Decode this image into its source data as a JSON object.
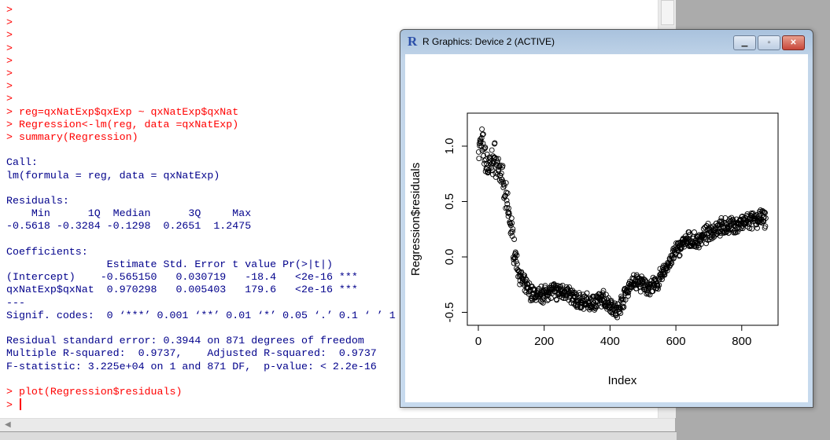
{
  "console": {
    "lines": [
      {
        "t": ">",
        "k": "in"
      },
      {
        "t": ">",
        "k": "in"
      },
      {
        "t": ">",
        "k": "in"
      },
      {
        "t": ">",
        "k": "in"
      },
      {
        "t": ">",
        "k": "in"
      },
      {
        "t": ">",
        "k": "in"
      },
      {
        "t": ">",
        "k": "in"
      },
      {
        "t": ">",
        "k": "in"
      },
      {
        "t": "> reg=qxNatExp$qxExp ~ qxNatExp$qxNat",
        "k": "in"
      },
      {
        "t": "> Regression<-lm(reg, data =qxNatExp)",
        "k": "in"
      },
      {
        "t": "> summary(Regression)",
        "k": "in"
      },
      {
        "t": "",
        "k": "out"
      },
      {
        "t": "Call:",
        "k": "out"
      },
      {
        "t": "lm(formula = reg, data = qxNatExp)",
        "k": "out"
      },
      {
        "t": "",
        "k": "out"
      },
      {
        "t": "Residuals:",
        "k": "out"
      },
      {
        "t": "    Min      1Q  Median      3Q     Max ",
        "k": "out"
      },
      {
        "t": "-0.5618 -0.3284 -0.1298  0.2651  1.2475 ",
        "k": "out"
      },
      {
        "t": "",
        "k": "out"
      },
      {
        "t": "Coefficients:",
        "k": "out"
      },
      {
        "t": "                Estimate Std. Error t value Pr(>|t|)    ",
        "k": "out"
      },
      {
        "t": "(Intercept)    -0.565150   0.030719   -18.4   <2e-16 ***",
        "k": "out"
      },
      {
        "t": "qxNatExp$qxNat  0.970298   0.005403   179.6   <2e-16 ***",
        "k": "out"
      },
      {
        "t": "---",
        "k": "out"
      },
      {
        "t": "Signif. codes:  0 ‘***’ 0.001 ‘**’ 0.01 ‘*’ 0.05 ‘.’ 0.1 ‘ ’ 1",
        "k": "out"
      },
      {
        "t": "",
        "k": "out"
      },
      {
        "t": "Residual standard error: 0.3944 on 871 degrees of freedom",
        "k": "out"
      },
      {
        "t": "Multiple R-squared:  0.9737,    Adjusted R-squared:  0.9737 ",
        "k": "out"
      },
      {
        "t": "F-statistic: 3.225e+04 on 1 and 871 DF,  p-value: < 2.2e-16",
        "k": "out"
      },
      {
        "t": "",
        "k": "out"
      },
      {
        "t": "> plot(Regression$residuals)",
        "k": "in"
      }
    ],
    "prompt": ">"
  },
  "graphics_window": {
    "title": "R Graphics: Device 2 (ACTIVE)",
    "logo": "R",
    "colors": {
      "title_bg": "#b9cfe6",
      "close": "#c8473a"
    }
  },
  "chart_data": {
    "type": "scatter",
    "title": "",
    "xlabel": "Index",
    "ylabel": "Regression$residuals",
    "xlim": [
      0,
      873
    ],
    "ylim": [
      -0.56,
      1.25
    ],
    "xticks": [
      "0",
      "200",
      "400",
      "600",
      "800"
    ],
    "yticks": [
      "-0.5",
      "0.0",
      "0.5",
      "1.0"
    ],
    "n": 873,
    "trend_index": [
      0,
      10,
      20,
      30,
      40,
      50,
      60,
      70,
      80,
      90,
      100,
      110,
      120,
      130,
      140,
      160,
      180,
      200,
      220,
      240,
      260,
      280,
      300,
      320,
      340,
      360,
      380,
      400,
      410,
      420,
      440,
      460,
      480,
      500,
      520,
      540,
      560,
      580,
      600,
      620,
      640,
      660,
      680,
      700,
      720,
      740,
      760,
      780,
      800,
      820,
      840,
      860,
      872
    ],
    "trend_value": [
      0.95,
      1.05,
      0.9,
      0.8,
      0.85,
      0.9,
      0.8,
      0.75,
      0.55,
      0.45,
      0.25,
      0.05,
      -0.1,
      -0.2,
      -0.25,
      -0.32,
      -0.35,
      -0.33,
      -0.3,
      -0.32,
      -0.3,
      -0.35,
      -0.4,
      -0.4,
      -0.42,
      -0.4,
      -0.38,
      -0.42,
      -0.45,
      -0.5,
      -0.38,
      -0.25,
      -0.22,
      -0.25,
      -0.28,
      -0.25,
      -0.15,
      -0.05,
      0.05,
      0.12,
      0.15,
      0.13,
      0.18,
      0.22,
      0.26,
      0.27,
      0.28,
      0.28,
      0.3,
      0.32,
      0.33,
      0.35,
      0.33
    ],
    "noise_amplitude": 0.09
  }
}
